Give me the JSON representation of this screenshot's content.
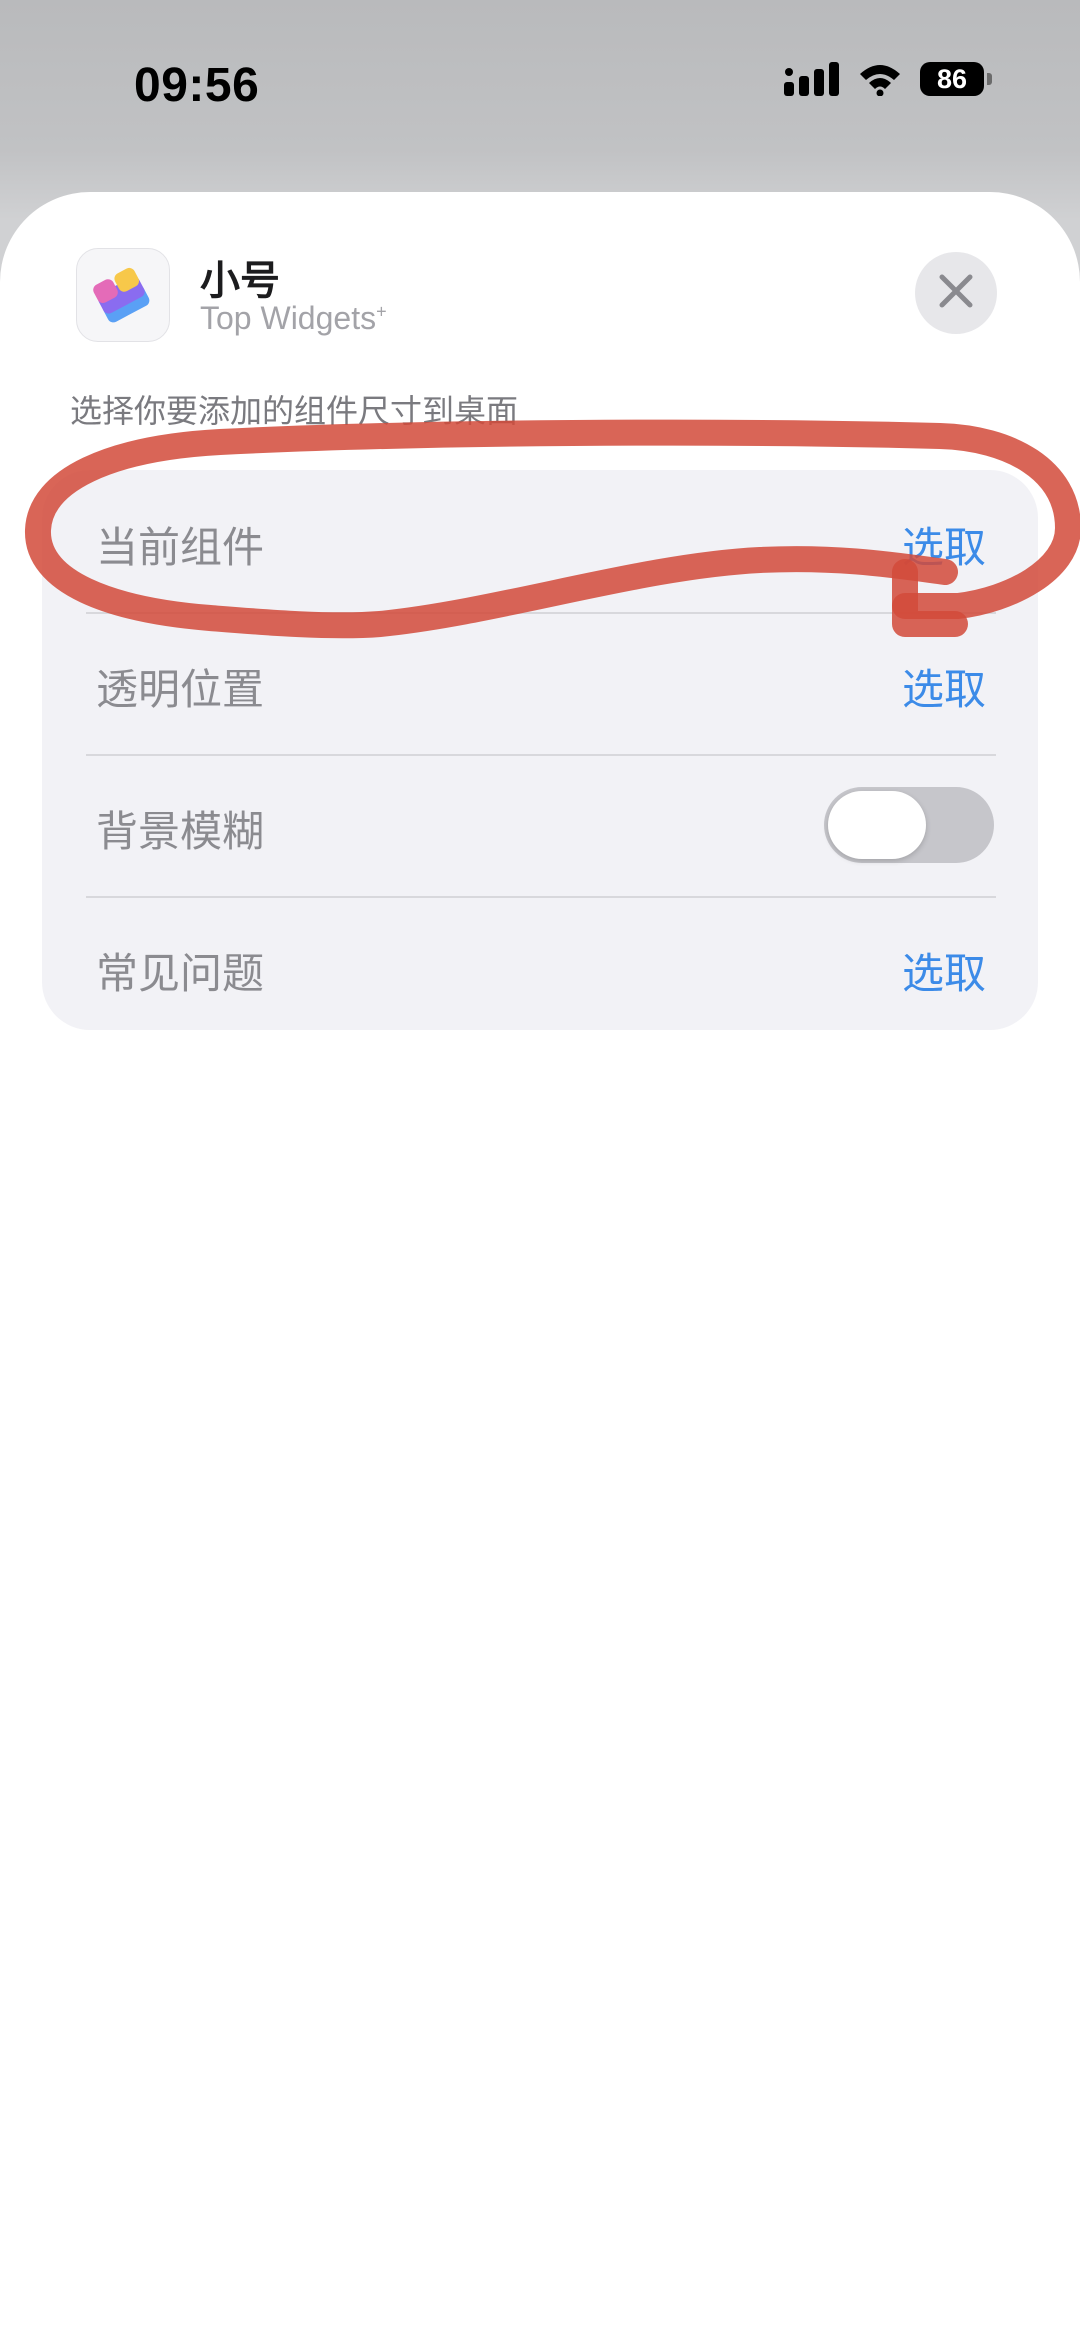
{
  "status_bar": {
    "time": "09:56",
    "battery_level": "86",
    "icons": [
      "signal-icon",
      "wifi-icon",
      "battery-icon"
    ]
  },
  "sheet": {
    "app_title": "小号",
    "app_subtitle": "Top Widgets",
    "app_subtitle_mark": "+",
    "description": "选择你要添加的组件尺寸到桌面",
    "close_icon": "close-icon"
  },
  "settings": {
    "rows": [
      {
        "label": "当前组件",
        "action": "选取",
        "type": "action"
      },
      {
        "label": "透明位置",
        "action": "选取",
        "type": "action"
      },
      {
        "label": "背景模糊",
        "type": "toggle",
        "toggle_on": false
      },
      {
        "label": "常见问题",
        "action": "选取",
        "type": "action"
      }
    ]
  },
  "colors": {
    "accent": "#3c8be8",
    "annotation": "#d24a3a",
    "toggle_off": "#c6c6cb",
    "card_background": "#f2f2f6"
  }
}
